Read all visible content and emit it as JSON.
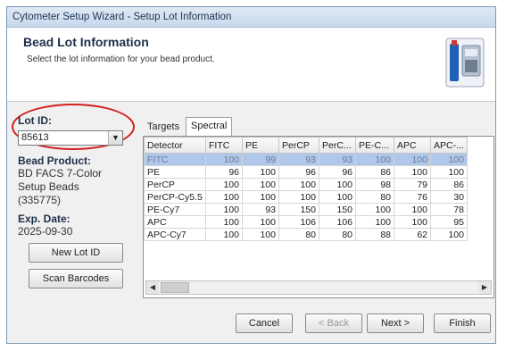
{
  "window": {
    "title": "Cytometer Setup Wizard - Setup Lot Information"
  },
  "header": {
    "title": "Bead Lot Information",
    "subtitle": "Select the lot information for your bead product."
  },
  "left": {
    "lot_id_label": "Lot ID:",
    "lot_id_value": "85613",
    "bead_product_label": "Bead Product:",
    "bead_product_lines": [
      "BD FACS 7-Color",
      "Setup Beads",
      "(335775)"
    ],
    "exp_date_label": "Exp. Date:",
    "exp_date_value": "2025-09-30",
    "new_lot_button": "New Lot ID",
    "scan_barcodes_button": "Scan Barcodes"
  },
  "tabs": [
    {
      "label": "Targets",
      "active": false
    },
    {
      "label": "Spectral Overlap Factors",
      "active": true
    }
  ],
  "table": {
    "columns": [
      "Detector",
      "FITC",
      "PE",
      "PerCP",
      "PerC...",
      "PE-C...",
      "APC",
      "APC-..."
    ],
    "rows": [
      {
        "cells": [
          "FITC",
          "100",
          "99",
          "93",
          "93",
          "100",
          "100",
          "100"
        ],
        "selected": true
      },
      {
        "cells": [
          "PE",
          "96",
          "100",
          "96",
          "96",
          "86",
          "100",
          "100"
        ],
        "selected": false
      },
      {
        "cells": [
          "PerCP",
          "100",
          "100",
          "100",
          "100",
          "98",
          "79",
          "86"
        ],
        "selected": false
      },
      {
        "cells": [
          "PerCP-Cy5.5",
          "100",
          "100",
          "100",
          "100",
          "80",
          "76",
          "30"
        ],
        "selected": false
      },
      {
        "cells": [
          "PE-Cy7",
          "100",
          "93",
          "150",
          "150",
          "100",
          "100",
          "78"
        ],
        "selected": false
      },
      {
        "cells": [
          "APC",
          "100",
          "100",
          "106",
          "106",
          "100",
          "100",
          "95"
        ],
        "selected": false
      },
      {
        "cells": [
          "APC-Cy7",
          "100",
          "100",
          "80",
          "80",
          "88",
          "62",
          "100"
        ],
        "selected": false
      }
    ]
  },
  "footer": {
    "cancel": "Cancel",
    "back": "< Back",
    "next": "Next >",
    "finish": "Finish"
  },
  "icons": [
    "chevron-down-icon",
    "cytometer-icon",
    "scroll-left-icon",
    "scroll-right-icon"
  ]
}
